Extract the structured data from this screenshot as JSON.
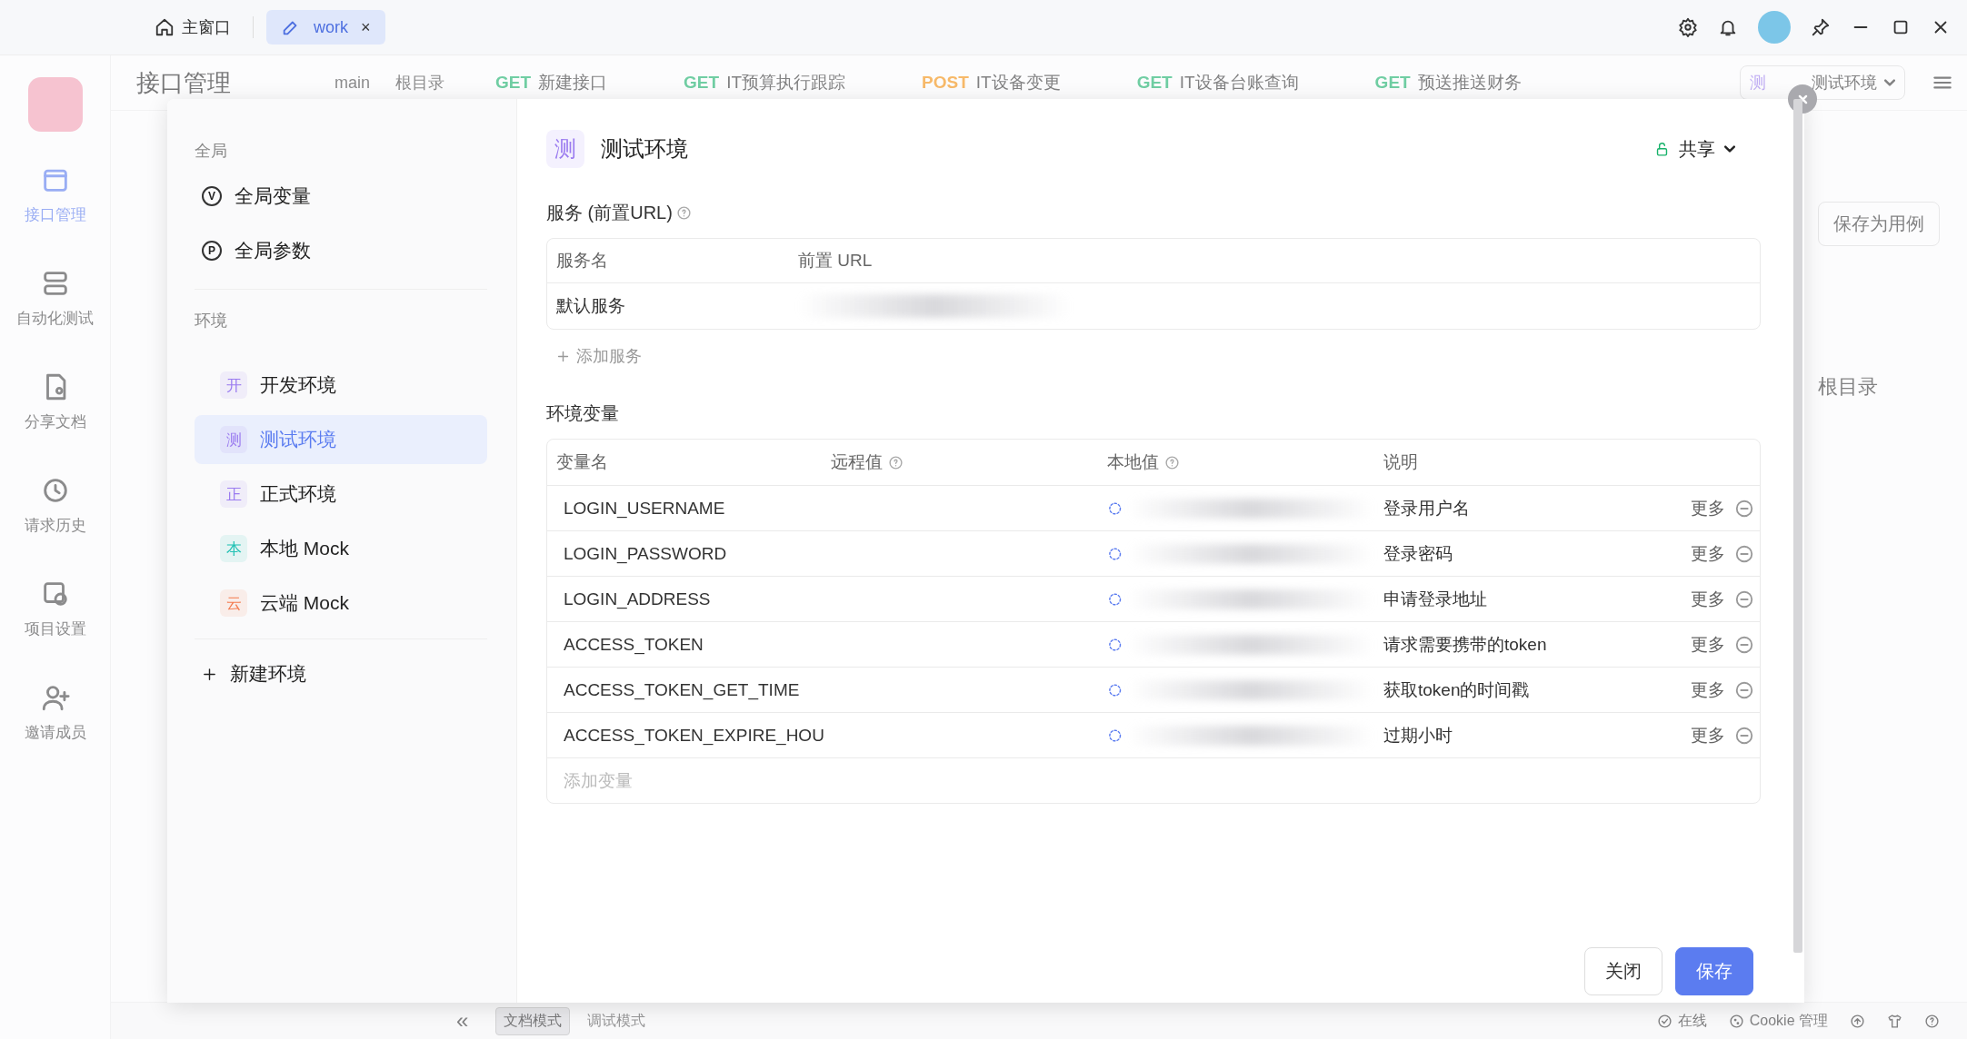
{
  "title_bar": {
    "home_tab": "主窗口",
    "tabs": [
      {
        "label": "work",
        "selected": true,
        "close": "×"
      }
    ]
  },
  "rail": {
    "items": [
      {
        "label": "接口管理",
        "selected": true,
        "kind": "api"
      },
      {
        "label": "自动化测试",
        "selected": false,
        "kind": "auto"
      },
      {
        "label": "分享文档",
        "selected": false,
        "kind": "doc"
      },
      {
        "label": "请求历史",
        "selected": false,
        "kind": "history"
      },
      {
        "label": "项目设置",
        "selected": false,
        "kind": "settings"
      },
      {
        "label": "邀请成员",
        "selected": false,
        "kind": "invite"
      }
    ]
  },
  "workspace": {
    "title": "接口管理",
    "branch": "main",
    "root": "根目录",
    "tabs": [
      {
        "method": "GET",
        "name": "新建接口"
      },
      {
        "method": "GET",
        "name": "IT预算执行跟踪"
      },
      {
        "method": "POST",
        "name": "IT设备变更"
      },
      {
        "method": "GET",
        "name": "IT设备台账查询"
      },
      {
        "method": "GET",
        "name": "预送推送财务"
      }
    ],
    "env_selector": {
      "badge": "测",
      "label": "测试环境"
    },
    "save_case": "保存为用例",
    "folder": "根目录"
  },
  "status_bar": {
    "collapse": "«",
    "modes": [
      {
        "label": "文档模式",
        "selected": true
      },
      {
        "label": "调试模式",
        "selected": false
      }
    ],
    "online": "在线",
    "cookie": "Cookie 管理"
  },
  "dialog": {
    "sidebar": {
      "global_heading": "全局",
      "global_items": [
        {
          "icon": "V",
          "label": "全局变量"
        },
        {
          "icon": "P",
          "label": "全局参数"
        }
      ],
      "env_heading": "环境",
      "environments": [
        {
          "badge": "开",
          "label": "开发环境",
          "color": "#9b7cf0",
          "selected": false
        },
        {
          "badge": "测",
          "label": "测试环境",
          "color": "#9b7cf0",
          "selected": true
        },
        {
          "badge": "正",
          "label": "正式环境",
          "color": "#9b7cf0",
          "selected": false
        },
        {
          "badge": "本",
          "label": "本地 Mock",
          "color": "#25c2b5",
          "selected": false
        },
        {
          "badge": "云",
          "label": "云端 Mock",
          "color": "#f47b4f",
          "selected": false
        }
      ],
      "new_env": "新建环境"
    },
    "header": {
      "badge": "测",
      "title": "测试环境",
      "share": "共享"
    },
    "services": {
      "heading": "服务 (前置URL)",
      "columns": [
        "服务名",
        "前置 URL"
      ],
      "rows": [
        {
          "name": "默认服务"
        }
      ],
      "add": "添加服务"
    },
    "variables": {
      "heading": "环境变量",
      "columns": [
        {
          "label": "变量名",
          "help": false
        },
        {
          "label": "远程值",
          "help": true
        },
        {
          "label": "本地值",
          "help": true
        },
        {
          "label": "说明",
          "help": false
        }
      ],
      "rows": [
        {
          "name": "LOGIN_USERNAME",
          "description": "登录用户名",
          "more": "更多"
        },
        {
          "name": "LOGIN_PASSWORD",
          "description": "登录密码",
          "more": "更多"
        },
        {
          "name": "LOGIN_ADDRESS",
          "description": "申请登录地址",
          "more": "更多"
        },
        {
          "name": "ACCESS_TOKEN",
          "description": "请求需要携带的token",
          "more": "更多"
        },
        {
          "name": "ACCESS_TOKEN_GET_TIME",
          "description": "获取token的时间戳",
          "more": "更多"
        },
        {
          "name": "ACCESS_TOKEN_EXPIRE_HOU",
          "description": "过期小时",
          "more": "更多"
        }
      ],
      "add_placeholder": "添加变量"
    },
    "buttons": [
      {
        "label": "关闭",
        "kind": "secondary"
      },
      {
        "label": "保存",
        "kind": "primary"
      }
    ]
  }
}
